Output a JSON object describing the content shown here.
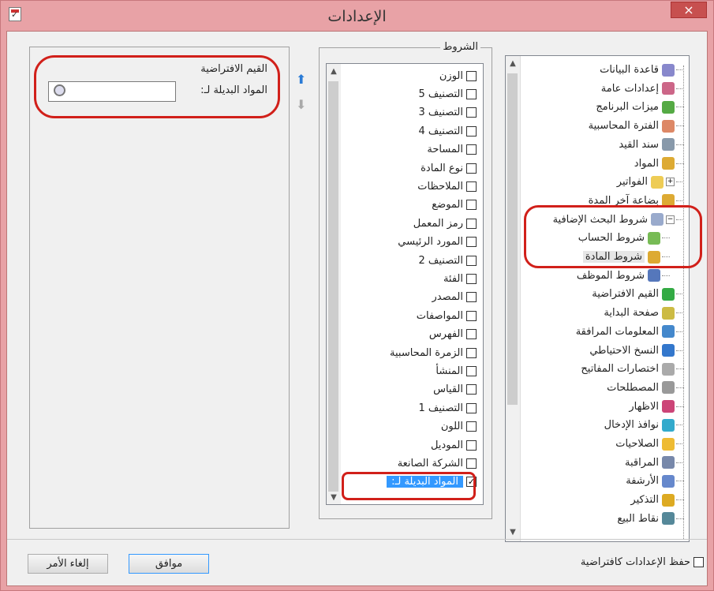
{
  "window": {
    "title": "الإعدادات",
    "close_glyph": "×"
  },
  "tree": {
    "items": [
      {
        "label": "قاعدة البيانات",
        "icon": "database-icon",
        "color": "#8888cc"
      },
      {
        "label": "إعدادات عامة",
        "icon": "settings-checklist-icon",
        "color": "#cc6688"
      },
      {
        "label": "ميزات البرنامج",
        "icon": "features-icon",
        "color": "#55aa44"
      },
      {
        "label": "الفترة المحاسبية",
        "icon": "calendar-icon",
        "color": "#dd8866"
      },
      {
        "label": "سند القيد",
        "icon": "document-icon",
        "color": "#8899aa"
      },
      {
        "label": "المواد",
        "icon": "box-icon",
        "color": "#ddaa33"
      },
      {
        "label": "الفواتير",
        "icon": "invoice-icon",
        "color": "#eecc55",
        "expander": "+"
      },
      {
        "label": "بضاعة آخر المدة",
        "icon": "box-icon",
        "color": "#ddaa33"
      },
      {
        "label": "شروط البحث الإضافية",
        "icon": "search-icon",
        "color": "#99aacc",
        "expander": "−"
      },
      {
        "label": "شروط الحساب",
        "icon": "account-icon",
        "color": "#77bb55",
        "child": true
      },
      {
        "label": "شروط المادة",
        "icon": "box-icon",
        "color": "#ddaa33",
        "child": true,
        "selected": true
      },
      {
        "label": "شروط الموظف",
        "icon": "employee-icon",
        "color": "#5577bb",
        "child": true
      },
      {
        "label": "القيم الافتراضية",
        "icon": "checkmark-icon",
        "color": "#33aa44"
      },
      {
        "label": "صفحة البداية",
        "icon": "start-page-icon",
        "color": "#ccbb44"
      },
      {
        "label": "المعلومات المرافقة",
        "icon": "info-icon",
        "color": "#4488cc"
      },
      {
        "label": "النسخ الاحتياطي",
        "icon": "backup-icon",
        "color": "#3377cc"
      },
      {
        "label": "اختصارات المفاتيح",
        "icon": "keyboard-icon",
        "color": "#aaaaaa"
      },
      {
        "label": "المصطلحات",
        "icon": "glossary-icon",
        "color": "#999999"
      },
      {
        "label": "الاظهار",
        "icon": "display-icon",
        "color": "#cc4477"
      },
      {
        "label": "نوافذ الإدخال",
        "icon": "input-window-icon",
        "color": "#33aacc"
      },
      {
        "label": "الصلاحيات",
        "icon": "lock-icon",
        "color": "#eebb33"
      },
      {
        "label": "المراقبة",
        "icon": "monitor-icon",
        "color": "#7788aa"
      },
      {
        "label": "الأرشفة",
        "icon": "archive-icon",
        "color": "#6688cc"
      },
      {
        "label": "التذكير",
        "icon": "reminder-icon",
        "color": "#ddaa22"
      },
      {
        "label": "نقاط البيع",
        "icon": "pos-icon",
        "color": "#558899"
      }
    ]
  },
  "conditions": {
    "legend": "الشروط",
    "items": [
      {
        "label": "الوزن",
        "checked": false
      },
      {
        "label": "التصنيف 5",
        "checked": false
      },
      {
        "label": "التصنيف 3",
        "checked": false
      },
      {
        "label": "التصنيف 4",
        "checked": false
      },
      {
        "label": "المساحة",
        "checked": false
      },
      {
        "label": "نوع المادة",
        "checked": false
      },
      {
        "label": "الملاحظات",
        "checked": false
      },
      {
        "label": "الموضع",
        "checked": false
      },
      {
        "label": "رمز المعمل",
        "checked": false
      },
      {
        "label": "المورد الرئيسي",
        "checked": false
      },
      {
        "label": "التصنيف 2",
        "checked": false
      },
      {
        "label": "الفئة",
        "checked": false
      },
      {
        "label": "المصدر",
        "checked": false
      },
      {
        "label": "المواصفات",
        "checked": false
      },
      {
        "label": "الفهرس",
        "checked": false
      },
      {
        "label": "الزمرة المحاسبية",
        "checked": false
      },
      {
        "label": "المنشأ",
        "checked": false
      },
      {
        "label": "القياس",
        "checked": false
      },
      {
        "label": "التصنيف 1",
        "checked": false
      },
      {
        "label": "اللون",
        "checked": false
      },
      {
        "label": "الموديل",
        "checked": false
      },
      {
        "label": "الشركة الصانعة",
        "checked": false
      },
      {
        "label": "المواد البديلة لـ:",
        "checked": true,
        "selected": true
      }
    ]
  },
  "defaults": {
    "title": "القيم الافتراضية",
    "field_label": "المواد البديلة لـ:",
    "field_value": ""
  },
  "footer": {
    "save_default_label": "حفظ الإعدادات كافتراضية",
    "ok_label": "موافق",
    "cancel_label": "إلغاء الأمر"
  },
  "colors": {
    "accent": "#3399ff",
    "highlight_oval": "#d1201a",
    "title_bar": "#e8a2a6"
  }
}
